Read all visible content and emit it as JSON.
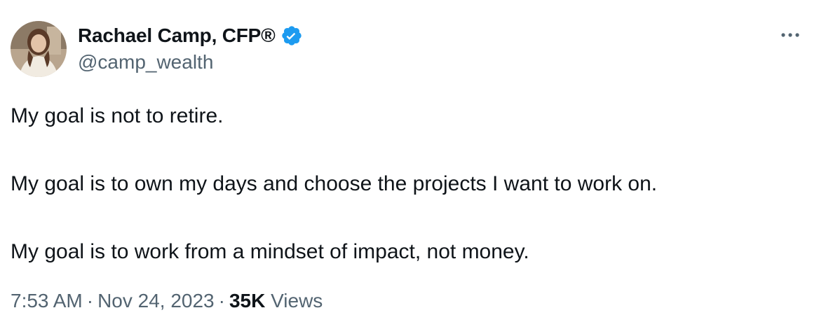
{
  "author": {
    "display_name": "Rachael Camp, CFP®",
    "handle": "@camp_wealth",
    "verified": true,
    "avatar_icon": "profile-photo",
    "verified_icon": "verified-badge-icon",
    "verified_color": "#1d9bf0"
  },
  "more_icon": "more-options-icon",
  "tweet": {
    "paragraphs": [
      "My goal is not to retire.",
      "My goal is to own my days and choose the projects I want to work on.",
      "My goal is to work from a mindset of impact, not money."
    ]
  },
  "meta": {
    "time": "7:53 AM",
    "separator": "·",
    "date": "Nov 24, 2023",
    "views_count": "35K",
    "views_label": "Views"
  },
  "colors": {
    "text_primary": "#0f1419",
    "text_secondary": "#536471",
    "accent": "#1d9bf0"
  }
}
